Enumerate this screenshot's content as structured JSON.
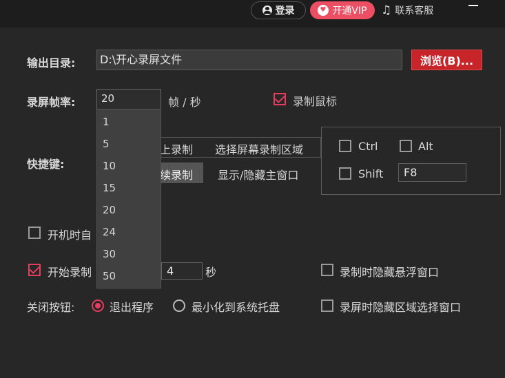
{
  "top_bar": {
    "login_label": "登录",
    "vip_label": "开通VIP",
    "service_label": "联系客服"
  },
  "output": {
    "label": "输出目录:",
    "path": "D:\\开心录屏文件",
    "browse_label": "浏览(B)..."
  },
  "fps": {
    "label": "录屏帧率:",
    "value": "20",
    "unit": "帧 / 秒",
    "options": [
      "1",
      "5",
      "10",
      "15",
      "20",
      "24",
      "30",
      "50"
    ]
  },
  "record_mouse": {
    "label": "录制鼠标",
    "checked": true
  },
  "hotkeys": {
    "label": "快捷键:",
    "row1_left": "上录制",
    "row1_right": "选择屏幕录制区域",
    "row2_left": "续录制",
    "row2_right": "显示/隐藏主窗口",
    "ctrl": "Ctrl",
    "alt": "Alt",
    "shift": "Shift",
    "key": "F8"
  },
  "startup": {
    "label": "开机时自",
    "checked": false
  },
  "countdown": {
    "label": "开始录制",
    "checked": true,
    "value": "4",
    "unit": "秒"
  },
  "hide_float": {
    "label": "录制时隐藏悬浮窗口",
    "checked": false
  },
  "close_button": {
    "label": "关闭按钮:",
    "exit_label": "退出程序",
    "tray_label": "最小化到系统托盘",
    "selected": "exit"
  },
  "hide_region": {
    "label": "录屏时隐藏区域选择窗口",
    "checked": false
  },
  "colors": {
    "accent": "#e63c5d",
    "browse": "#c8252a",
    "vip": "#ec4f63"
  }
}
